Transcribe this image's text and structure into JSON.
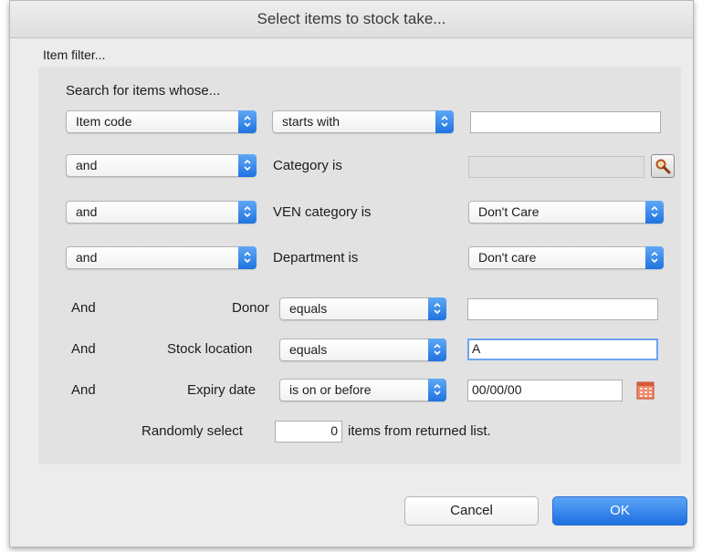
{
  "window": {
    "title": "Select items to stock take..."
  },
  "filter": {
    "group_label": "Item filter...",
    "search_heading": "Search for items whose...",
    "row1": {
      "field_select": "Item code",
      "operator_select": "starts with",
      "value": ""
    },
    "row2": {
      "conjunction": "and",
      "label": "Category is",
      "value": ""
    },
    "row3": {
      "conjunction": "and",
      "label": "VEN category is",
      "value_select": "Don't Care"
    },
    "row4": {
      "conjunction": "and",
      "label": "Department is",
      "value_select": "Don't care"
    },
    "donor": {
      "and": "And",
      "label": "Donor",
      "operator": "equals",
      "value": ""
    },
    "location": {
      "and": "And",
      "label": "Stock location",
      "operator": "equals",
      "value": "A"
    },
    "expiry": {
      "and": "And",
      "label": "Expiry date",
      "operator": "is on or before",
      "value": "00/00/00"
    },
    "random": {
      "label_before": "Randomly select",
      "count": "0",
      "label_after": "items from returned list."
    }
  },
  "buttons": {
    "cancel": "Cancel",
    "ok": "OK"
  },
  "icons": {
    "lookup": "magnifier-icon",
    "calendar": "calendar-icon",
    "popup_arrows": "chevron-updown-icon"
  },
  "colors": {
    "accent": "#2f7fea",
    "ok_button": "#1e6fe0"
  }
}
